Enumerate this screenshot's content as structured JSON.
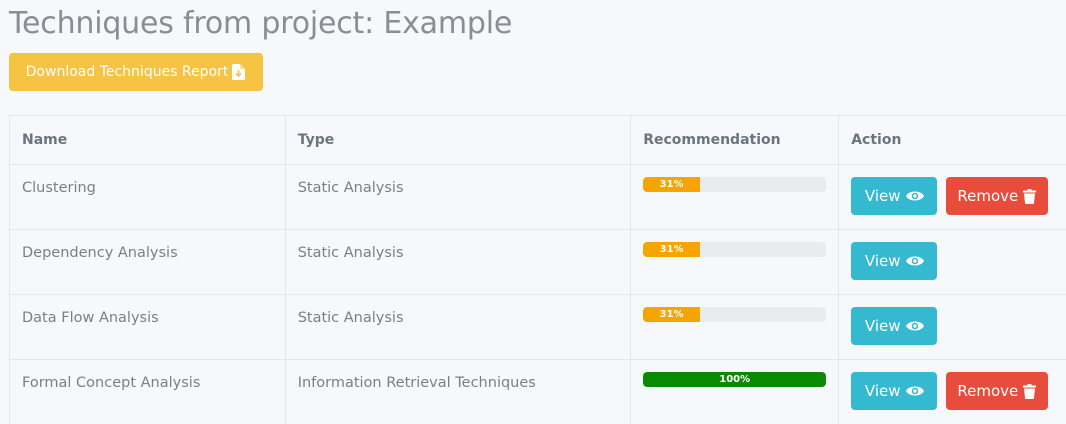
{
  "page": {
    "title": "Techniques from project: Example"
  },
  "toolbar": {
    "download_label": "Download Techniques Report",
    "download_icon": "file-download-icon"
  },
  "table": {
    "headers": [
      "Name",
      "Type",
      "Recommendation",
      "Action"
    ],
    "rows": [
      {
        "name": "Clustering",
        "type": "Static Analysis",
        "recommendation": 31,
        "recommendation_label": "31%",
        "bar_color": "#f5a400",
        "show_remove": true
      },
      {
        "name": "Dependency Analysis",
        "type": "Static Analysis",
        "recommendation": 31,
        "recommendation_label": "31%",
        "bar_color": "#f5a400",
        "show_remove": false
      },
      {
        "name": "Data Flow Analysis",
        "type": "Static Analysis",
        "recommendation": 31,
        "recommendation_label": "31%",
        "bar_color": "#f5a400",
        "show_remove": false
      },
      {
        "name": "Formal Concept Analysis",
        "type": "Information Retrieval Techniques",
        "recommendation": 100,
        "recommendation_label": "100%",
        "bar_color": "#0a8a00",
        "show_remove": true
      }
    ]
  },
  "actions": {
    "view_label": "View",
    "view_icon": "eye-icon",
    "remove_label": "Remove",
    "remove_icon": "trash-icon"
  },
  "colors": {
    "download_button": "#f6c343",
    "view_button": "#35b9d0",
    "remove_button": "#e74c3c"
  }
}
